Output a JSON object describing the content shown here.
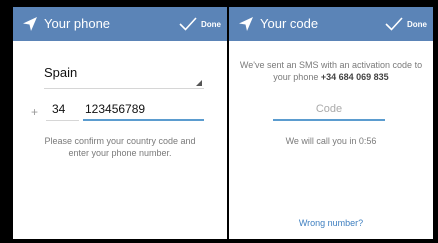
{
  "left_screen": {
    "title": "Your phone",
    "done_label": "Done",
    "country": "Spain",
    "plus_sign": "+",
    "country_code": "34",
    "phone_number": "123456789",
    "help_text": "Please confirm your country code and enter your phone number."
  },
  "right_screen": {
    "title": "Your code",
    "done_label": "Done",
    "sms_text_prefix": "We've sent an SMS with an activation code to your phone",
    "sms_phone": "+34 684 069 835",
    "code_placeholder": "Code",
    "call_text": "We will call you in 0:56",
    "wrong_number": "Wrong number?"
  },
  "colors": {
    "topbar": "#5b84b7",
    "accent_underline": "#5b9ccf",
    "link": "#3e7fc0",
    "background": "#ffffff",
    "frame": "#000000"
  },
  "icons": [
    "send-icon",
    "checkmark-icon",
    "dropdown-arrow-icon"
  ]
}
